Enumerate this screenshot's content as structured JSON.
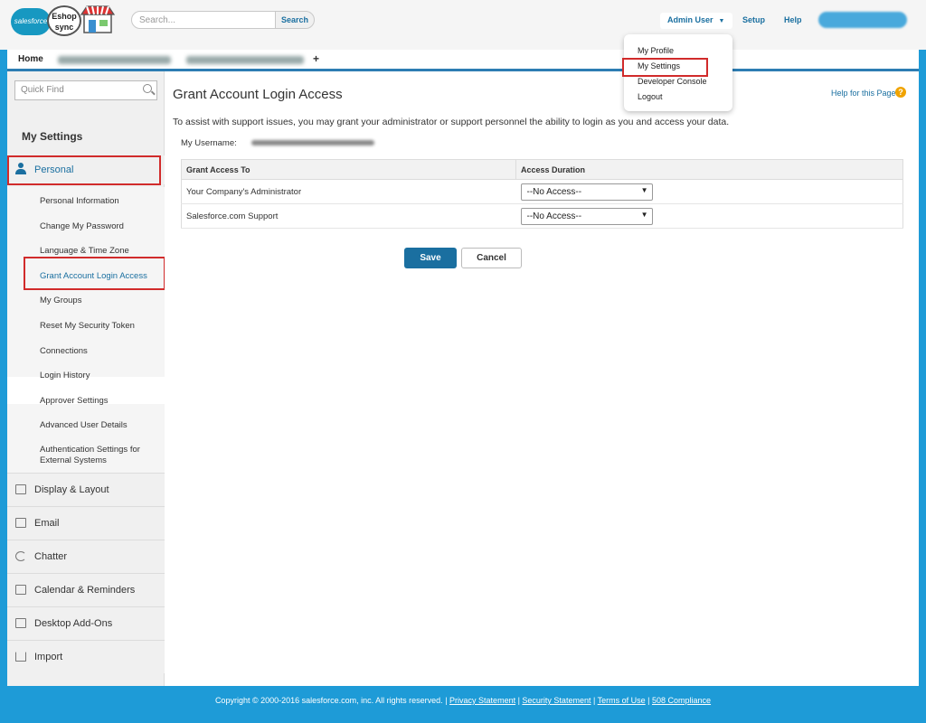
{
  "header": {
    "logo_salesforce": "salesforce",
    "logo_eshop": "Eshop sync",
    "search_placeholder": "Search...",
    "search_button": "Search",
    "user_menu_label": "Admin User",
    "setup_label": "Setup",
    "help_label": "Help",
    "caret_icon": "caret-down-icon"
  },
  "user_dropdown": {
    "items": [
      {
        "label": "My Profile"
      },
      {
        "label": "My Settings"
      },
      {
        "label": "Developer Console"
      },
      {
        "label": "Logout"
      }
    ]
  },
  "tabs": {
    "home_label": "Home",
    "add_tab_label": "+"
  },
  "sidebar": {
    "quick_find_placeholder": "Quick Find",
    "title": "My Settings",
    "personal_label": "Personal",
    "personal_items": [
      {
        "label": "Personal Information"
      },
      {
        "label": "Change My Password"
      },
      {
        "label": "Language & Time Zone"
      },
      {
        "label": "Grant Account Login Access"
      },
      {
        "label": "My Groups"
      },
      {
        "label": "Reset My Security Token"
      },
      {
        "label": "Connections"
      },
      {
        "label": "Login History"
      },
      {
        "label": "Approver Settings"
      },
      {
        "label": "Advanced User Details"
      },
      {
        "label": "Authentication Settings for External Systems"
      }
    ],
    "sections": [
      {
        "label": "Display & Layout",
        "icon": "layout-icon"
      },
      {
        "label": "Email",
        "icon": "envelope-icon"
      },
      {
        "label": "Chatter",
        "icon": "chatter-icon"
      },
      {
        "label": "Calendar & Reminders",
        "icon": "calendar-icon"
      },
      {
        "label": "Desktop Add-Ons",
        "icon": "desktop-addons-icon"
      },
      {
        "label": "Import",
        "icon": "import-icon"
      }
    ]
  },
  "main": {
    "title": "Grant Account Login Access",
    "help_link": "Help for this Page",
    "intro": "To assist with support issues, you may grant your administrator or support personnel the ability to login as you and access your data.",
    "username_label": "My Username:",
    "table": {
      "headers": [
        "Grant Access To",
        "Access Duration"
      ],
      "rows": [
        {
          "name": "Your Company's Administrator",
          "duration": "--No Access--"
        },
        {
          "name": "Salesforce.com Support",
          "duration": "--No Access--"
        }
      ]
    },
    "save_label": "Save",
    "cancel_label": "Cancel"
  },
  "footer": {
    "copyright": "Copyright © 2000-2016 salesforce.com, inc. All rights reserved. |",
    "links": [
      {
        "label": "Privacy Statement"
      },
      {
        "label": "Security Statement"
      },
      {
        "label": "Terms of Use"
      },
      {
        "label": "508 Compliance"
      }
    ]
  },
  "colors": {
    "brand_blue": "#1e9bd7",
    "link_blue": "#1a6fa0",
    "highlight_red": "#d12b2b"
  }
}
